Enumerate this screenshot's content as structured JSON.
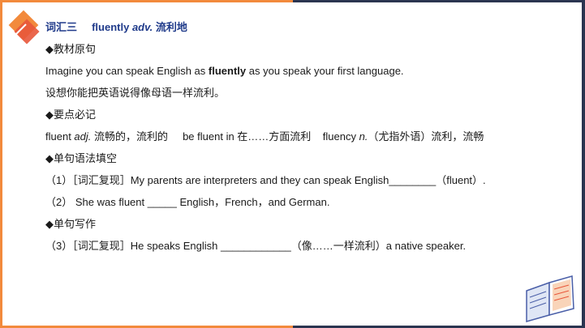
{
  "title": {
    "prefix": "词汇三",
    "word": "fluently",
    "pos": "adv.",
    "meaning": "流利地"
  },
  "section1": {
    "heading": "◆教材原句",
    "sentence_before": "Imagine you can speak English as ",
    "sentence_bold": "fluently",
    "sentence_after": " as you speak your first language.",
    "translation": "设想你能把英语说得像母语一样流利。"
  },
  "section2": {
    "heading": "◆要点必记",
    "part1_a": "fluent ",
    "part1_pos": "adj.",
    "part1_b": " 流畅的，流利的",
    "part2": "be fluent in 在……方面流利",
    "part3_a": "fluency ",
    "part3_pos": "n.",
    "part3_b": "（尤指外语）流利，流畅"
  },
  "section3": {
    "heading": "◆单句语法填空",
    "q1": "（1）［词汇复现］My parents are interpreters and they can speak English________（fluent）.",
    "q2": "（2） She was fluent _____ English，French，and German."
  },
  "section4": {
    "heading": "◆单句写作",
    "q3": "（3）［词汇复现］He speaks English ____________（像……一样流利）a native speaker."
  },
  "colors": {
    "accent_orange": "#f28a3c",
    "dark_navy": "#2b3550",
    "title_blue": "#1f3a8a"
  }
}
